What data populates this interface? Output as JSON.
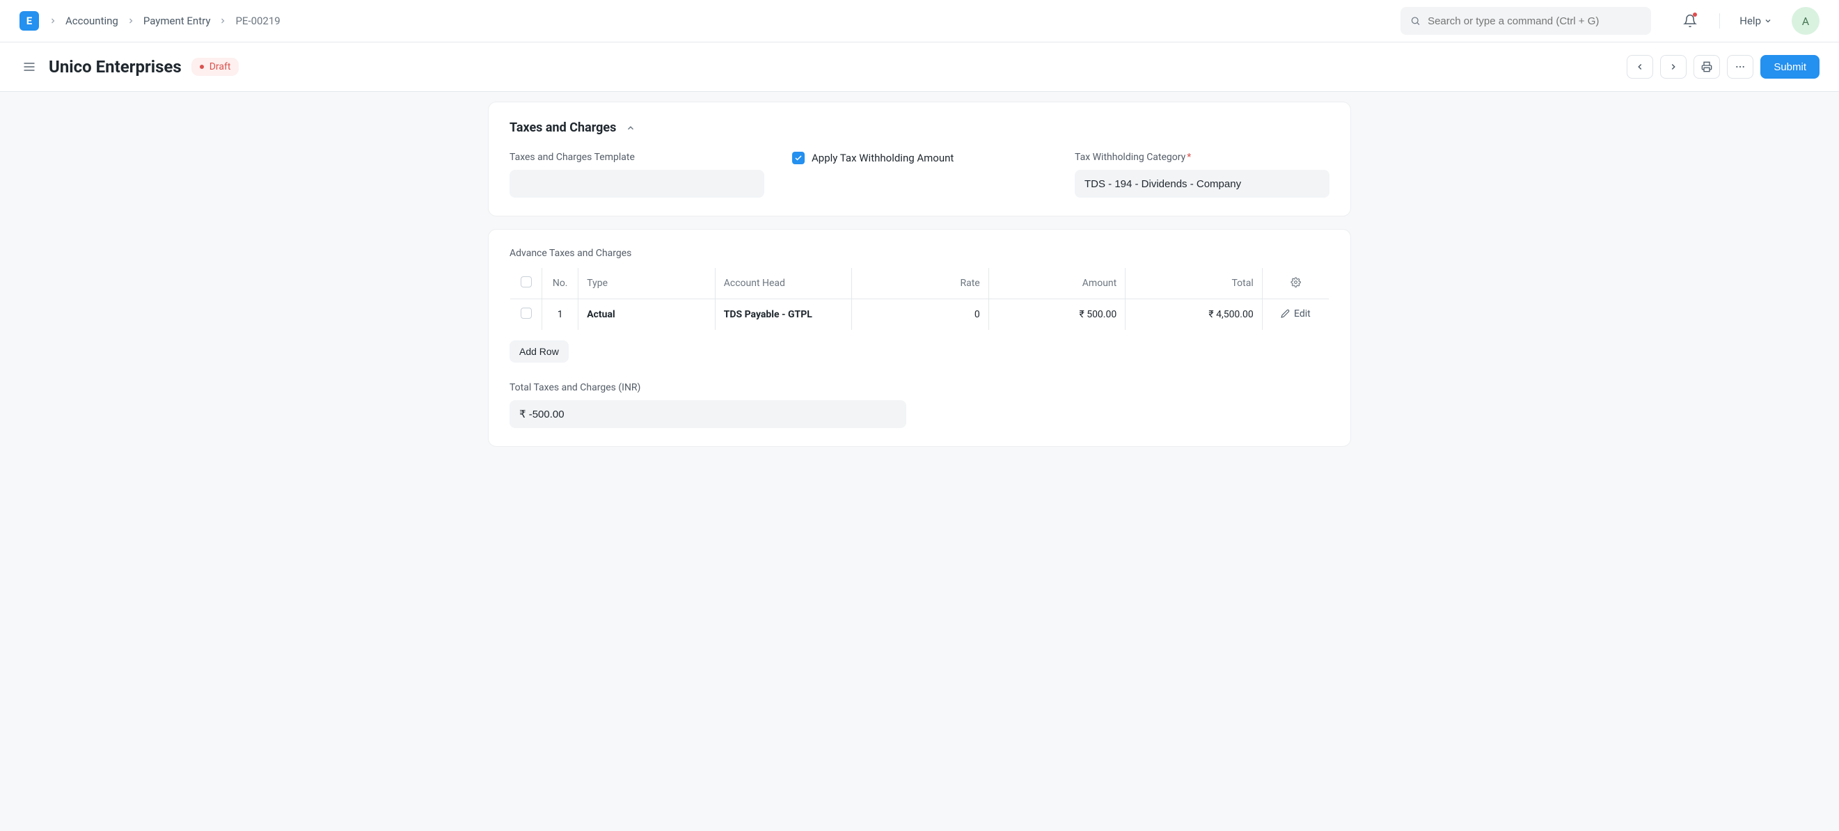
{
  "brand_initial": "E",
  "breadcrumb": {
    "items": [
      "Accounting",
      "Payment Entry"
    ],
    "current": "PE-00219"
  },
  "search": {
    "placeholder": "Search or type a command (Ctrl + G)"
  },
  "help_label": "Help",
  "avatar_initial": "A",
  "page": {
    "title": "Unico Enterprises",
    "status": "Draft",
    "submit_label": "Submit"
  },
  "section_taxes": {
    "title": "Taxes and Charges",
    "template_label": "Taxes and Charges Template",
    "template_value": "",
    "apply_withholding_label": "Apply Tax Withholding Amount",
    "apply_withholding_checked": true,
    "withholding_category_label": "Tax Withholding Category",
    "withholding_category_required": true,
    "withholding_category_value": "TDS - 194 - Dividends - Company"
  },
  "advance_table": {
    "label": "Advance Taxes and Charges",
    "headers": {
      "no": "No.",
      "type": "Type",
      "account_head": "Account Head",
      "rate": "Rate",
      "amount": "Amount",
      "total": "Total"
    },
    "rows": [
      {
        "no": "1",
        "type": "Actual",
        "account_head": "TDS Payable - GTPL",
        "rate": "0",
        "amount": "₹ 500.00",
        "total": "₹ 4,500.00"
      }
    ],
    "edit_label": "Edit",
    "add_row_label": "Add Row"
  },
  "totals": {
    "label": "Total Taxes and Charges (INR)",
    "value": "₹ -500.00"
  }
}
